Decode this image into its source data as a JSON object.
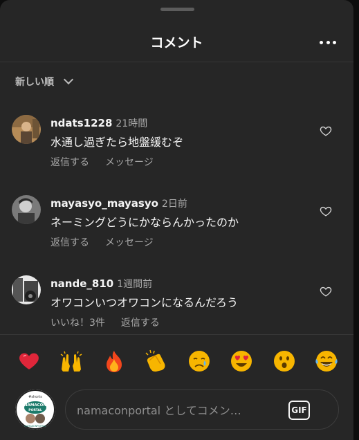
{
  "header": {
    "title": "コメント",
    "more_icon": "more-horizontal-icon"
  },
  "sort": {
    "label": "新しい順",
    "icon": "chevron-down-icon"
  },
  "comments": [
    {
      "user": "ndats1228",
      "time": "21時間",
      "text": "水通し過ぎたら地盤緩むぞ",
      "actions": [
        "返信する",
        "メッセージ"
      ],
      "liked": false
    },
    {
      "user": "mayasyo_mayasyo",
      "time": "2日前",
      "text": "ネーミングどうにかならんかったのか",
      "actions": [
        "返信する",
        "メッセージ"
      ],
      "liked": false
    },
    {
      "user": "nande_810",
      "time": "1週間前",
      "text": "オワコンいつオワコンになるんだろう",
      "actions": [
        "いいね！3件",
        "返信する"
      ],
      "liked": false
    }
  ],
  "emojis": [
    "❤️",
    "🙌",
    "🔥",
    "👏",
    "😢",
    "😍",
    "😮",
    "😂"
  ],
  "composer": {
    "placeholder": "namaconportal としてコメン…",
    "gif_label": "GIF",
    "avatar_text": {
      "top": "#shorts",
      "mid": "NAMACON",
      "sub": "PORTAL",
      "bottom": "NAMAKONPORTAL"
    }
  },
  "colors": {
    "background": "#262626",
    "text": "#f5f5f5",
    "secondary": "#a8a8a8"
  }
}
